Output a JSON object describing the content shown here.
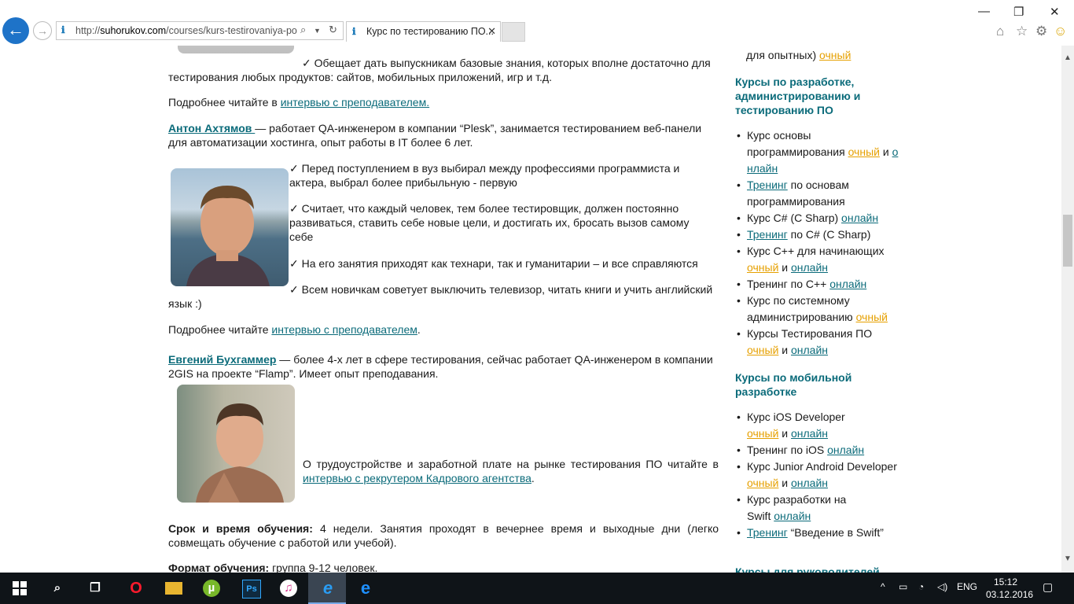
{
  "browser": {
    "url_prefix": "http://",
    "url_domain": "suhorukov.com",
    "url_path": "/courses/kurs-testirovaniya-po",
    "tab_title": "Курс по тестированию ПО..."
  },
  "content": {
    "p1": "✓ Обещает дать выпускникам базовые знания, которых вполне достаточно для тестирования любых продуктов: сайтов, мобильных приложений, игр и т.д.",
    "more1_prefix": "Подробнее читайте в ",
    "more1_link": "интервью с преподавателем.",
    "anton_name": "Антон Ахтямов ",
    "anton_desc": "— работает QA-инженером в компании “Plesk”, занимается тестированием веб-панели для автоматизации хостинга, опыт работы в IT более 6 лет.",
    "anton_b1": "✓ Перед поступлением в вуз выбирал между профессиями программиста и актера, выбрал более прибыльную - первую",
    "anton_b2": "✓ Считает, что каждый человек, тем более тестировщик, должен постоянно  развиваться, ставить себе новые цели, и достигать их, бросать вызов самому себе",
    "anton_b3": "✓ На его занятия приходят как технари, так и гуманитарии – и все справляются",
    "anton_b4": "✓ Всем новичкам советует выключить телевизор, читать книги и учить английский язык :)",
    "more2_prefix": "Подробнее читайте ",
    "more2_link": "интервью с преподавателем",
    "more2_suffix": ".",
    "evg_name": "Евгений Бухгаммер",
    "evg_desc": " — более 4-х лет в сфере тестирования, сейчас работает QA-инженером в компании 2GIS на проекте “Flamp”. Имеет опыт преподавания.",
    "evg_side": "О трудоустройстве и заработной плате на рынке тестирования ПО читайте в ",
    "evg_link": "интервью с рекрутером Кадрового агентства",
    "evg_suffix": ".",
    "term_label": "Срок и время обучения:",
    "term_text": " 4 недели. Занятия проходят в вечернее время и выходные дни (легко совмещать обучение с работой или учебой).",
    "format_label": "Формат обучения:",
    "format_text": " группа 9-12 человек."
  },
  "sidebar": {
    "top_text": "для опытных) ",
    "top_link": "очный",
    "h1": "Курсы по разработке, администрированию и тестированию ПО",
    "h2": "Курсы по мобильной разработке",
    "h3": "Курсы для руководителей",
    "s1": {
      "i1a": "Курс основы программирования ",
      "i1b": "очный",
      "i1c": " и ",
      "i1d": "онлайн",
      "i2a": "Тренинг",
      "i2b": " по основам программирования",
      "i3a": "Курс C# (C Sharp) ",
      "i3b": "онлайн",
      "i4a": "Тренинг",
      "i4b": " по C# (C Sharp)",
      "i5a": "Курс C++ для начинающих ",
      "i5b": "очный",
      "i5c": " и ",
      "i5d": "онлайн",
      "i6a": "Тренинг по C++ ",
      "i6b": "онлайн",
      "i7a": "Курс по системному администрированию ",
      "i7b": "очный",
      "i8a": "Курсы Тестирования ПО ",
      "i8b": "очный",
      "i8c": " и ",
      "i8d": "онлайн"
    },
    "s2": {
      "i1a": "Курс iOS Developer ",
      "i1b": "очный",
      "i1c": " и ",
      "i1d": "онлайн",
      "i2a": "Тренинг по iOS ",
      "i2b": "онлайн",
      "i3a": "Курс Junior Android Developer ",
      "i3b": "очный",
      "i3c": " и ",
      "i3d": "онлайн",
      "i4a": "Курс разработки на Swift ",
      "i4b": "онлайн",
      "i5a": "Тренинг",
      "i5b": " “Введение в Swift”"
    }
  },
  "taskbar": {
    "lang": "ENG",
    "time": "15:12",
    "date": "03.12.2016"
  }
}
